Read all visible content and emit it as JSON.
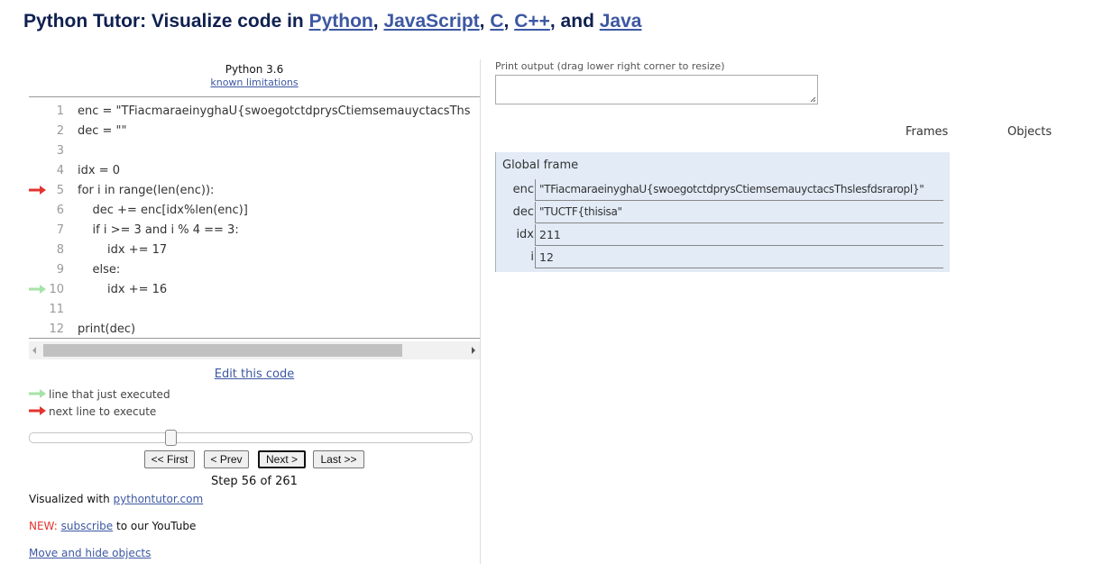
{
  "header": {
    "title_prefix": "Python Tutor: Visualize code in ",
    "langs": [
      "Python",
      "JavaScript",
      "C",
      "C++",
      "Java"
    ],
    "sep1": ", ",
    "sep2": ", ",
    "sep3": ", ",
    "sep4": ", and "
  },
  "editor": {
    "language": "Python 3.6",
    "limitations_link": "known limitations",
    "lines": [
      {
        "num": "1",
        "code": "enc = \"TFiacmaraeinyghaU{swoegotctdprysCtiemsemauyctacsThs"
      },
      {
        "num": "2",
        "code": "dec = \"\""
      },
      {
        "num": "3",
        "code": ""
      },
      {
        "num": "4",
        "code": "idx = 0"
      },
      {
        "num": "5",
        "code": "for i in range(len(enc)):"
      },
      {
        "num": "6",
        "code": "    dec += enc[idx%len(enc)]"
      },
      {
        "num": "7",
        "code": "    if i >= 3 and i % 4 == 3:"
      },
      {
        "num": "8",
        "code": "        idx += 17"
      },
      {
        "num": "9",
        "code": "    else:"
      },
      {
        "num": "10",
        "code": "        idx += 16"
      },
      {
        "num": "11",
        "code": ""
      },
      {
        "num": "12",
        "code": "print(dec)"
      }
    ],
    "next_line": 5,
    "just_executed_line": 10,
    "edit_link": "Edit this code"
  },
  "legend": {
    "just_executed": "line that just executed",
    "next_to_execute": "next line to execute",
    "colors": {
      "just_executed": "#a6e3a8",
      "next": "#e3342f"
    }
  },
  "navigation": {
    "first": "<< First",
    "prev": "< Prev",
    "next": "Next >",
    "last": "Last >>",
    "step_text": "Step 56 of 261",
    "current_step": 56,
    "total_steps": 261
  },
  "footer": {
    "visualized_prefix": "Visualized with ",
    "visualized_link": "pythontutor.com",
    "new_label": "NEW:",
    "subscribe_link": "subscribe",
    "subscribe_suffix": " to our YouTube",
    "move_hide_link": "Move and hide objects"
  },
  "output": {
    "label": "Print output (drag lower right corner to resize)",
    "text": ""
  },
  "visualization": {
    "frames_header": "Frames",
    "objects_header": "Objects",
    "frame_title": "Global frame",
    "variables": [
      {
        "name": "enc",
        "value": "\"TFiacmaraeinyghaU{swoegotctdprysCtiemsemauyctacsThslesfdsraropl}\""
      },
      {
        "name": "dec",
        "value": "\"TUCTF{thisisa\""
      },
      {
        "name": "idx",
        "value": "211"
      },
      {
        "name": "i",
        "value": "12"
      }
    ]
  }
}
